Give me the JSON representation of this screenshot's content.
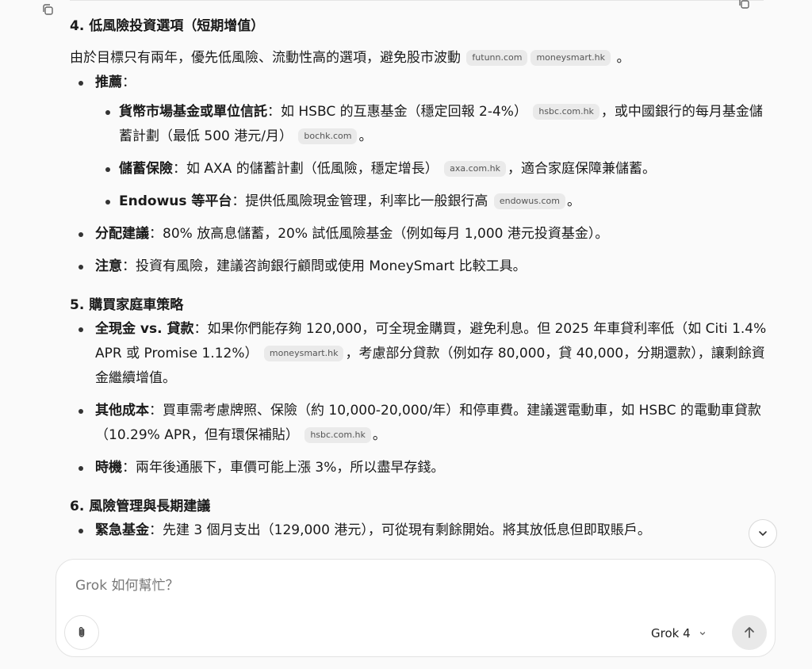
{
  "section4": {
    "heading": "4. 低風險投資選項（短期增值）",
    "intro": "由於目標只有兩年，優先低風險、流動性高的選項，避免股市波動",
    "intro_chips": [
      "futunn.com",
      "moneysmart.hk"
    ],
    "intro_end": "。",
    "recommend_label": "推薦",
    "recommend_colon": "：",
    "sub_items": [
      {
        "label": "貨幣市場基金或單位信託",
        "text1": "：如 HSBC 的互惠基金（穩定回報 2-4%）",
        "chip1": "hsbc.com.hk",
        "text2": "，或中國銀行的每月基金儲蓄計劃（最低 500 港元/月）",
        "chip2": "bochk.com",
        "end": "。"
      },
      {
        "label": "儲蓄保險",
        "text1": "：如 AXA 的儲蓄計劃（低風險，穩定增長）",
        "chip1": "axa.com.hk",
        "text2": "，適合家庭保障兼儲蓄。"
      },
      {
        "label": "Endowus 等平台",
        "text1": "：提供低風險現金管理，利率比一般銀行高",
        "chip1": "endowus.com",
        "text2": "。"
      }
    ],
    "allocation_label": "分配建議",
    "allocation_text": "：80% 放高息儲蓄，20% 試低風險基金（例如每月 1,000 港元投資基金）。",
    "note_label": "注意",
    "note_text": "：投資有風險，建議咨詢銀行顧問或使用 MoneySmart 比較工具。"
  },
  "section5": {
    "heading": "5. 購買家庭車策略",
    "items": [
      {
        "label": "全現金 vs. 貸款",
        "text1": "：如果你們能存夠 120,000，可全現金購買，避免利息。但 2025 年車貸利率低（如 Citi 1.4% APR 或 Promise 1.12%）",
        "chip1": "moneysmart.hk",
        "text2": "，考慮部分貸款（例如存 80,000，貸 40,000，分期還款），讓剩餘資金繼續增值。"
      },
      {
        "label": "其他成本",
        "text1": "：買車需考慮牌照、保險（約 10,000-20,000/年）和停車費。建議選電動車，如 HSBC 的電動車貸款（10.29% APR，但有環保補貼）",
        "chip1": "hsbc.com.hk",
        "text2": "。"
      },
      {
        "label": "時機",
        "text1": "：兩年後通脹下，車價可能上漲 3%，所以盡早存錢。"
      }
    ]
  },
  "section6": {
    "heading": "6. 風險管理與長期建議",
    "first_item_label": "緊急基金",
    "first_item_text": "：先建 3 個月支出（129,000 港元），可從現有剩餘開始。將其放低息但即取賬戶。"
  },
  "composer": {
    "placeholder": "Grok 如何幫忙？",
    "model": "Grok 4"
  }
}
